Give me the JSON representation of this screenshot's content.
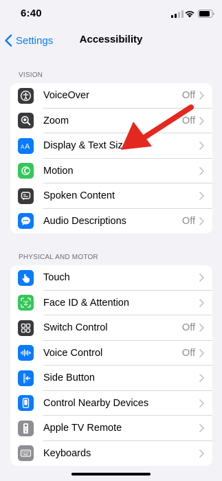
{
  "status_bar": {
    "time": "6:40"
  },
  "nav": {
    "back_label": "Settings",
    "title": "Accessibility"
  },
  "sections": [
    {
      "header": "VISION",
      "items": [
        {
          "label": "VoiceOver",
          "value": "Off",
          "icon": "voiceover-icon",
          "color": "#3a3a3c"
        },
        {
          "label": "Zoom",
          "value": "Off",
          "icon": "zoom-icon",
          "color": "#3a3a3c"
        },
        {
          "label": "Display & Text Size",
          "value": "",
          "icon": "text-size-icon",
          "color": "#0a7aff"
        },
        {
          "label": "Motion",
          "value": "",
          "icon": "motion-icon",
          "color": "#34c759"
        },
        {
          "label": "Spoken Content",
          "value": "",
          "icon": "spoken-content-icon",
          "color": "#3a3a3c"
        },
        {
          "label": "Audio Descriptions",
          "value": "Off",
          "icon": "audio-descriptions-icon",
          "color": "#0a7aff"
        }
      ]
    },
    {
      "header": "PHYSICAL AND MOTOR",
      "items": [
        {
          "label": "Touch",
          "value": "",
          "icon": "touch-icon",
          "color": "#0a7aff"
        },
        {
          "label": "Face ID & Attention",
          "value": "",
          "icon": "face-id-icon",
          "color": "#34c759"
        },
        {
          "label": "Switch Control",
          "value": "Off",
          "icon": "switch-control-icon",
          "color": "#3a3a3c"
        },
        {
          "label": "Voice Control",
          "value": "Off",
          "icon": "voice-control-icon",
          "color": "#0a7aff"
        },
        {
          "label": "Side Button",
          "value": "",
          "icon": "side-button-icon",
          "color": "#0a7aff"
        },
        {
          "label": "Control Nearby Devices",
          "value": "",
          "icon": "nearby-devices-icon",
          "color": "#0a7aff"
        },
        {
          "label": "Apple TV Remote",
          "value": "",
          "icon": "tv-remote-icon",
          "color": "#8e8e93"
        },
        {
          "label": "Keyboards",
          "value": "",
          "icon": "keyboard-icon",
          "color": "#8e8e93"
        }
      ]
    }
  ],
  "colors": {
    "accent": "#0a7aff",
    "annotation_arrow": "#e5281f"
  }
}
